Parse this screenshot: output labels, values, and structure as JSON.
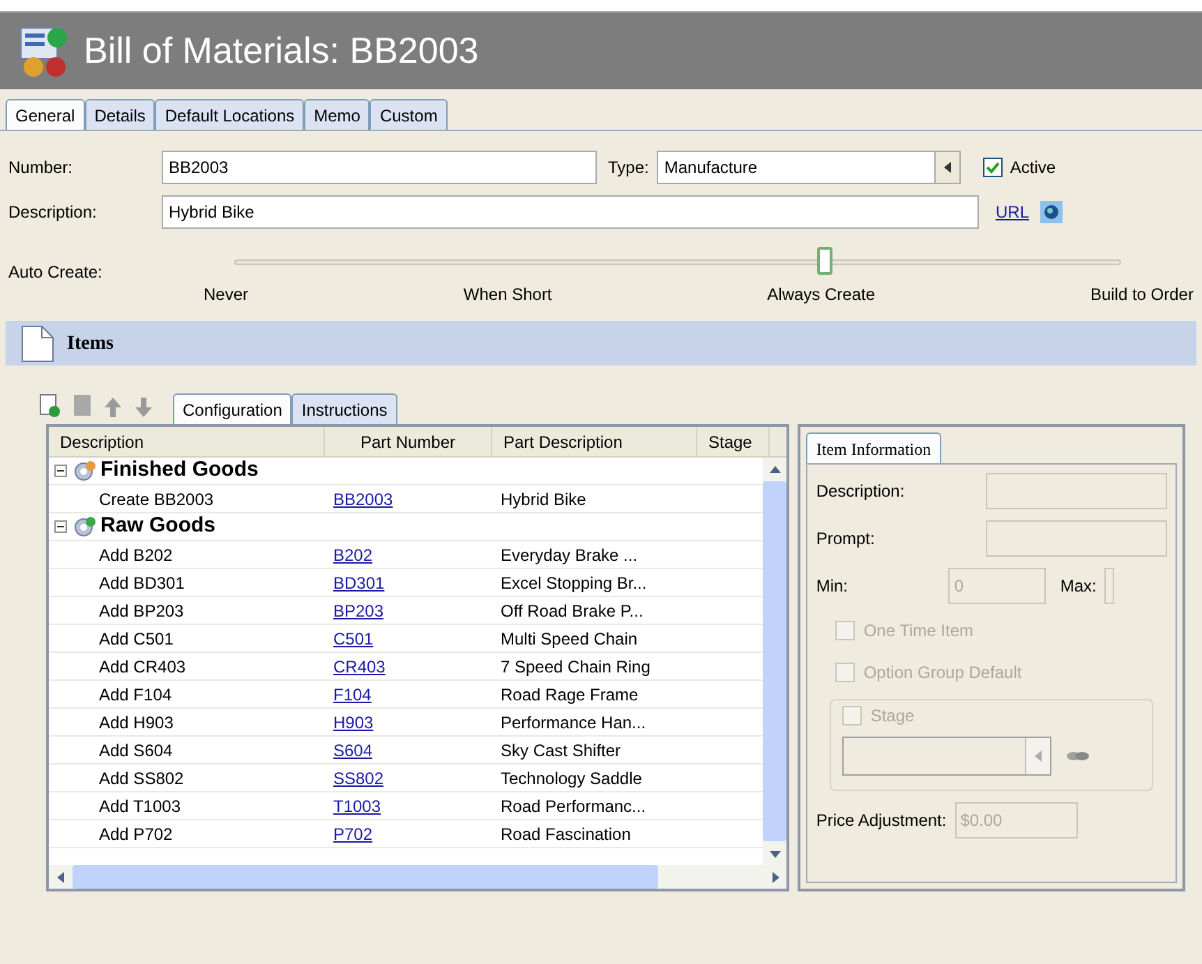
{
  "window": {
    "title": "Bill of Materials: BB2003"
  },
  "tabs": [
    {
      "label": "General",
      "selected": true
    },
    {
      "label": "Details",
      "selected": false
    },
    {
      "label": "Default Locations",
      "selected": false
    },
    {
      "label": "Memo",
      "selected": false
    },
    {
      "label": "Custom",
      "selected": false
    }
  ],
  "form": {
    "number": {
      "label": "Number:",
      "value": "BB2003"
    },
    "type": {
      "label": "Type:",
      "value": "Manufacture"
    },
    "active": {
      "label": "Active",
      "checked": true
    },
    "description": {
      "label": "Description:",
      "value": "Hybrid Bike"
    },
    "url": {
      "label": "URL"
    },
    "auto_create": {
      "label": "Auto Create:",
      "level": 0.667,
      "stops": [
        "Never",
        "When Short",
        "Always Create",
        "Build to Order"
      ]
    }
  },
  "items": {
    "title": "Items",
    "subtabs": [
      {
        "label": "Configuration",
        "selected": true
      },
      {
        "label": "Instructions",
        "selected": false
      }
    ],
    "columns": [
      "Description",
      "Part Number",
      "Part Description",
      "Stage"
    ],
    "groups": [
      {
        "kind": "finished",
        "label": "Finished Goods",
        "expanded": true,
        "children": [
          {
            "description": "Create BB2003",
            "part_number": "BB2003",
            "part_description": "Hybrid Bike"
          }
        ]
      },
      {
        "kind": "raw",
        "label": "Raw Goods",
        "expanded": true,
        "children": [
          {
            "description": "Add B202",
            "part_number": "B202",
            "part_description": "Everyday Brake ..."
          },
          {
            "description": "Add BD301",
            "part_number": "BD301",
            "part_description": "Excel Stopping Br..."
          },
          {
            "description": "Add BP203",
            "part_number": "BP203",
            "part_description": "Off Road Brake P..."
          },
          {
            "description": "Add C501",
            "part_number": "C501",
            "part_description": "Multi Speed Chain"
          },
          {
            "description": "Add CR403",
            "part_number": "CR403",
            "part_description": "7 Speed Chain Ring"
          },
          {
            "description": "Add F104",
            "part_number": "F104",
            "part_description": "Road Rage Frame"
          },
          {
            "description": "Add H903",
            "part_number": "H903",
            "part_description": "Performance Han..."
          },
          {
            "description": "Add S604",
            "part_number": "S604",
            "part_description": "Sky Cast Shifter"
          },
          {
            "description": "Add SS802",
            "part_number": "SS802",
            "part_description": "Technology Saddle"
          },
          {
            "description": "Add T1003",
            "part_number": "T1003",
            "part_description": "Road Performanc..."
          },
          {
            "description": "Add P702",
            "part_number": "P702",
            "part_description": "Road Fascination"
          }
        ]
      }
    ]
  },
  "item_information": {
    "tab": "Item Information",
    "disabled": true,
    "description_label": "Description:",
    "prompt_label": "Prompt:",
    "min_label": "Min:",
    "min_value": "0",
    "max_label": "Max:",
    "checkboxes": [
      {
        "label": "One Time Item",
        "checked": false
      },
      {
        "label": "Option Group Default",
        "checked": false
      }
    ],
    "stage": {
      "label": "Stage",
      "checked": false
    },
    "price_label": "Price Adjustment:",
    "price_value": "$0.00"
  }
}
